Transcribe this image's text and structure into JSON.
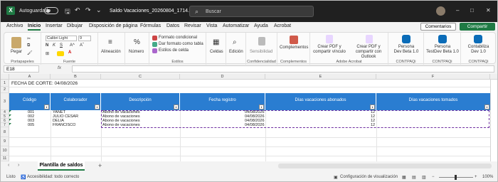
{
  "titlebar": {
    "app_letter": "X",
    "autosave_label": "Autoguardado",
    "file_name": "Saldo Vacaciones_20260804_1714...",
    "search_placeholder": "Buscar",
    "qa_icons": [
      "save-icon",
      "undo-icon",
      "redo-icon",
      "more-icon"
    ]
  },
  "menu": {
    "tabs": [
      "Archivo",
      "Inicio",
      "Insertar",
      "Dibujar",
      "Disposición de página",
      "Fórmulas",
      "Datos",
      "Revisar",
      "Vista",
      "Automatizar",
      "Ayuda",
      "Acrobat"
    ],
    "active_index": 1,
    "comments_label": "Comentarios",
    "share_label": "Compartir"
  },
  "ribbon": {
    "clipboard": {
      "paste": "Pegar",
      "label": "Portapapeles"
    },
    "font": {
      "name": "Calibri Light",
      "size": "9",
      "label": "Fuente"
    },
    "alignment": {
      "label": "Alineación"
    },
    "number": {
      "label": "Número"
    },
    "styles": {
      "cond_format": "Formato condicional",
      "table_format": "Dar formato como tabla",
      "cell_styles": "Estilos de celda",
      "label": "Estilos"
    },
    "cells": {
      "label": "Celdas"
    },
    "editing": {
      "label": "Edición"
    },
    "sensitivity": {
      "label": "Sensibilidad",
      "group": "Confidencialidad"
    },
    "addins": {
      "label": "Complementos",
      "group": "Complementos"
    },
    "acrobat": {
      "pdf_link": "Crear PDF y compartir vínculo",
      "pdf_outlook": "Crear PDF y compartir con Outlook",
      "group": "Adobe Acrobat"
    },
    "contpaqi": [
      {
        "line1": "Persona",
        "line2": "Dev Beta 1.0",
        "group": "CONTPAQi"
      },
      {
        "line1": "Persona",
        "line2": "TestDev Beta 1.0",
        "group": "CONTPAQi"
      },
      {
        "line1": "Contabiliza",
        "line2": "Dev 1.0",
        "group": "CONTPAQi"
      }
    ]
  },
  "formula_bar": {
    "cell_ref": "E18",
    "fx": "fx",
    "value": ""
  },
  "sheet": {
    "columns": [
      "A",
      "B",
      "C",
      "D",
      "E",
      "F"
    ],
    "rows": [
      "1",
      "2",
      "3",
      "4",
      "5",
      "6",
      "7",
      "8",
      "9",
      "10",
      "11"
    ],
    "title": "FECHA DE CORTE: 04/08/2026",
    "headers": [
      "Código",
      "Colaborador",
      "Descripción",
      "Fecha registro",
      "Días vacaciones abonados",
      "Días vacaciones tomados"
    ],
    "data": [
      [
        "001",
        "YANET",
        "Abono de vacaciones",
        "04/08/2026",
        "12",
        ""
      ],
      [
        "002",
        "JULIO CESAR",
        "Abono de vacaciones",
        "04/08/2026",
        "12",
        ""
      ],
      [
        "003",
        "DELIA",
        "Abono de vacaciones",
        "04/08/2026",
        "12",
        ""
      ],
      [
        "005",
        "FRANCISCO",
        "Abono de vacaciones",
        "04/08/2026",
        "12",
        ""
      ]
    ]
  },
  "sheet_tabs": {
    "active": "Plantilla de saldos",
    "add": "+"
  },
  "status": {
    "ready": "Listo",
    "accessibility": "Accesibilidad: todo correcto",
    "display": "Configuración de visualización",
    "zoom": "100%"
  },
  "colors": {
    "accent": "#1f7a44",
    "header_fill": "#2a7dd1",
    "selection": "#7030a0"
  }
}
